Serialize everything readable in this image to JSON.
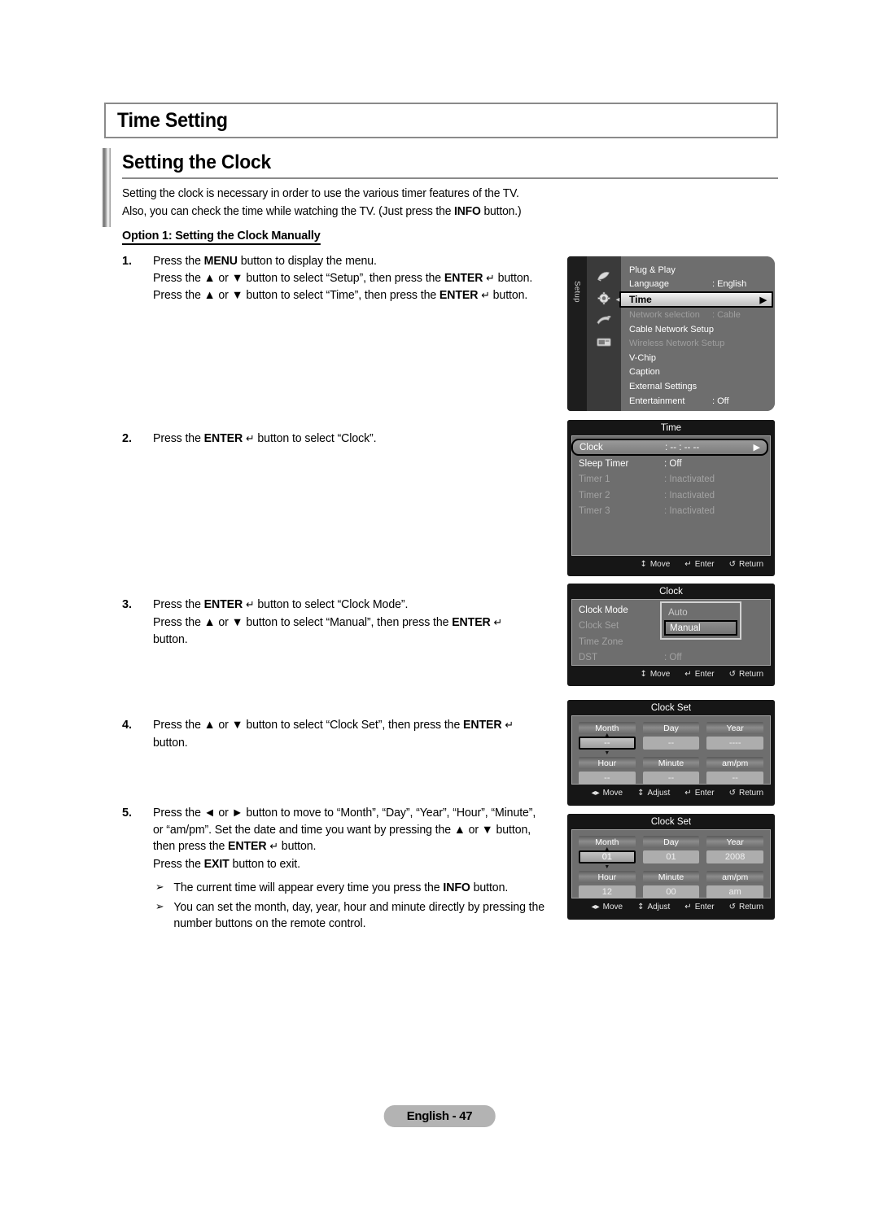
{
  "page": {
    "chapter_title": "Time Setting",
    "section_heading": "Setting the Clock",
    "intro_line_1": "Setting the clock is necessary in order to use the various timer features of the TV.",
    "intro_line_2_a": "Also, you can check the time while watching the TV. (Just press the ",
    "intro_line_2_bold": "INFO",
    "intro_line_2_b": " button.)",
    "option_label": "Option 1: Setting the Clock Manually",
    "footer_badge": "English - 47"
  },
  "steps": {
    "s1": {
      "num": "1.",
      "l1_a": "Press the ",
      "l1_bold": "MENU",
      "l1_b": " button to display the menu.",
      "l2_a": "Press the ▲ or ▼ button to select “Setup”, then press the ",
      "l2_bold": "ENTER",
      "l2_glyph": "↵",
      "l2_b": " button.",
      "l3_a": "Press the ▲ or ▼ button to select “Time”, then press the ",
      "l3_bold": "ENTER",
      "l3_glyph": "↵",
      "l3_b": " button."
    },
    "s2": {
      "num": "2.",
      "l1_a": "Press the ",
      "l1_bold": "ENTER",
      "l1_glyph": "↵",
      "l1_b": " button to select “Clock”."
    },
    "s3": {
      "num": "3.",
      "l1_a": "Press the ",
      "l1_bold": "ENTER",
      "l1_glyph": "↵",
      "l1_b": " button to select “Clock Mode”.",
      "l2_a": "Press the ▲ or ▼ button to select “Manual”, then press the ",
      "l2_bold": "ENTER",
      "l2_glyph": "↵",
      "l3": "button."
    },
    "s4": {
      "num": "4.",
      "l1_a": "Press the ▲ or ▼ button to select “Clock Set”, then press the ",
      "l1_bold": "ENTER",
      "l1_glyph": "↵",
      "l2": "button."
    },
    "s5": {
      "num": "5.",
      "l1": "Press the ◄ or ► button to move to “Month”, “Day”, “Year”, “Hour”, “Minute”,",
      "l2": "or “am/pm”. Set the date and time you want by pressing the ▲ or ▼ button,",
      "l3_a": "then press the ",
      "l3_bold": "ENTER",
      "l3_glyph": "↵",
      "l3_b": " button.",
      "l4_a": "Press the ",
      "l4_bold": "EXIT",
      "l4_b": " button to exit.",
      "note1_a": "The current time will appear every time you press the ",
      "note1_bold": "INFO",
      "note1_b": " button.",
      "note2": "You can set the month, day, year, hour and minute directly by pressing the number buttons on the remote control.",
      "note_arrow": "➢"
    }
  },
  "osd": {
    "setup_panel": {
      "rail_label": "Setup",
      "icons": [
        "picture-icon",
        "gear-icon",
        "plug-icon",
        "input-icon"
      ],
      "items": [
        {
          "label": "Plug & Play",
          "value": "",
          "state": "normal"
        },
        {
          "label": "Language",
          "value": ": English",
          "state": "normal"
        },
        {
          "label": "Time",
          "value": "",
          "state": "selected",
          "caret": "▶"
        },
        {
          "label": "Network selection",
          "value": ": Cable",
          "state": "dim"
        },
        {
          "label": "Cable Network Setup",
          "value": "",
          "state": "normal"
        },
        {
          "label": "Wireless Network Setup",
          "value": "",
          "state": "dim"
        },
        {
          "label": "V-Chip",
          "value": "",
          "state": "normal"
        },
        {
          "label": "Caption",
          "value": "",
          "state": "normal"
        },
        {
          "label": "External Settings",
          "value": "",
          "state": "normal"
        },
        {
          "label": "Entertainment",
          "value": ": Off",
          "state": "normal"
        }
      ]
    },
    "time_panel": {
      "title": "Time",
      "rows": [
        {
          "label": "Clock",
          "value": ": -- : -- --",
          "state": "selected",
          "caret": "▶"
        },
        {
          "label": "Sleep Timer",
          "value": ": Off",
          "state": "normal"
        },
        {
          "label": "Timer 1",
          "value": ": Inactivated",
          "state": "dim"
        },
        {
          "label": "Timer 2",
          "value": ": Inactivated",
          "state": "dim"
        },
        {
          "label": "Timer 3",
          "value": ": Inactivated",
          "state": "dim"
        }
      ],
      "hints": [
        {
          "glyph": "↕",
          "label": "Move"
        },
        {
          "glyph": "↵",
          "label": "Enter"
        },
        {
          "glyph": "↺",
          "label": "Return"
        }
      ]
    },
    "clock_panel": {
      "title": "Clock",
      "rows": [
        {
          "label": "Clock Mode",
          "value": ":",
          "state": "normal"
        },
        {
          "label": "Clock Set",
          "value": "",
          "state": "dim"
        },
        {
          "label": "Time Zone",
          "value": "",
          "state": "dim"
        },
        {
          "label": "DST",
          "value": ": Off",
          "state": "dim"
        }
      ],
      "dropdown": [
        {
          "label": "Auto",
          "state": "normal"
        },
        {
          "label": "Manual",
          "state": "selected"
        }
      ],
      "hints": [
        {
          "glyph": "↕",
          "label": "Move"
        },
        {
          "glyph": "↵",
          "label": "Enter"
        },
        {
          "glyph": "↺",
          "label": "Return"
        }
      ]
    },
    "clock_set_empty": {
      "title": "Clock Set",
      "cells": [
        {
          "label": "Month",
          "value": "--",
          "state": "selected"
        },
        {
          "label": "Day",
          "value": "--",
          "state": "normal"
        },
        {
          "label": "Year",
          "value": "----",
          "state": "normal"
        },
        {
          "label": "Hour",
          "value": "--",
          "state": "normal"
        },
        {
          "label": "Minute",
          "value": "--",
          "state": "normal"
        },
        {
          "label": "am/pm",
          "value": "--",
          "state": "normal"
        }
      ],
      "hints": [
        {
          "glyph": "◂▸",
          "label": "Move"
        },
        {
          "glyph": "↕",
          "label": "Adjust"
        },
        {
          "glyph": "↵",
          "label": "Enter"
        },
        {
          "glyph": "↺",
          "label": "Return"
        }
      ]
    },
    "clock_set_filled": {
      "title": "Clock Set",
      "cells": [
        {
          "label": "Month",
          "value": "01",
          "state": "selected"
        },
        {
          "label": "Day",
          "value": "01",
          "state": "normal"
        },
        {
          "label": "Year",
          "value": "2008",
          "state": "normal"
        },
        {
          "label": "Hour",
          "value": "12",
          "state": "normal"
        },
        {
          "label": "Minute",
          "value": "00",
          "state": "normal"
        },
        {
          "label": "am/pm",
          "value": "am",
          "state": "normal"
        }
      ],
      "hints": [
        {
          "glyph": "◂▸",
          "label": "Move"
        },
        {
          "glyph": "↕",
          "label": "Adjust"
        },
        {
          "glyph": "↵",
          "label": "Enter"
        },
        {
          "glyph": "↺",
          "label": "Return"
        }
      ]
    }
  }
}
